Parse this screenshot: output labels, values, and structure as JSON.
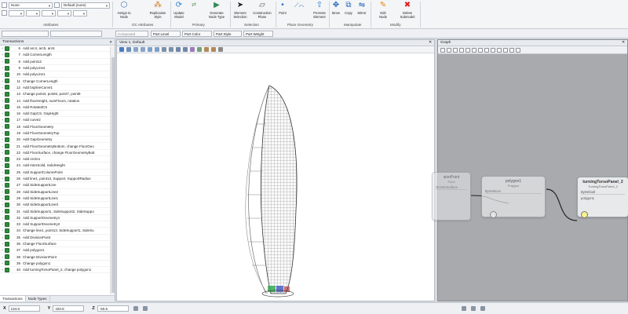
{
  "ribbon": {
    "combos": {
      "level": "None",
      "template": "Default (none)"
    },
    "groups": {
      "attributes": "Attributes",
      "gc_attributes": "GC Attributes",
      "primary": "Primary",
      "selection": "Selection",
      "place_geometry": "Place Geometry",
      "manipulate": "Manipulate",
      "modify": "Modify"
    },
    "buttons": {
      "assign_to_node": "Assign to Node",
      "replication_style": "Replication Style",
      "update_model": "Update Model",
      "generate_node_type": "Generate Node Type",
      "element_selection": "Element Selection",
      "construction_plane": "Construction Plane",
      "point": "Point",
      "promote_element": "Promote Element",
      "move": "Move",
      "copy": "Copy",
      "mirror": "Mirror",
      "edit_node": "Edit Node",
      "delete_submodel": "Delete Submodel"
    }
  },
  "toolbar2": {
    "compound": "Compound",
    "part_level": "Part Level",
    "part_color": "Part Color",
    "part_style": "Part Style",
    "part_weight": "Part Weight"
  },
  "transactions": {
    "title": "Transactions",
    "rows": [
      {
        "n": "6",
        "label": "Add arc4, arc5, arc6"
      },
      {
        "n": "7",
        "label": "Add CornerLength"
      },
      {
        "n": "8",
        "label": "Add point12"
      },
      {
        "n": "9",
        "label": "Add polyLine2"
      },
      {
        "n": "10",
        "label": "Add polyLine1"
      },
      {
        "n": "11",
        "label": "Change CornerLength"
      },
      {
        "n": "12",
        "label": "Add bsplineCurve1"
      },
      {
        "n": "13",
        "label": "Change point4, point6, point7, point8"
      },
      {
        "n": "14",
        "label": "Add floorHeight, numFloors, rotation"
      },
      {
        "n": "15",
        "label": "Add RotatedCS"
      },
      {
        "n": "16",
        "label": "Add GapCS, GapHight"
      },
      {
        "n": "17",
        "label": "Add curve2"
      },
      {
        "n": "18",
        "label": "Add FloorGeometry"
      },
      {
        "n": "19",
        "label": "Add FloorGeometryTop"
      },
      {
        "n": "20",
        "label": "Add GapGeometry"
      },
      {
        "n": "21",
        "label": "Add FloorGeometryBottom, change FloorGeo"
      },
      {
        "n": "22",
        "label": "Add FloorSurface, change FloorGeometryBott"
      },
      {
        "n": "23",
        "label": "Add circle1"
      },
      {
        "n": "24",
        "label": "Add InterSolid, SolidHeight"
      },
      {
        "n": "25",
        "label": "Add SupportColumnPoint"
      },
      {
        "n": "26",
        "label": "Add line1, point13, Support, SupportRadius"
      },
      {
        "n": "27",
        "label": "Add SideSupportLine"
      },
      {
        "n": "28",
        "label": "Add SideSupportLine2"
      },
      {
        "n": "29",
        "label": "Add SideSupportLine1"
      },
      {
        "n": "30",
        "label": "Add SideSupportLine3"
      },
      {
        "n": "31",
        "label": "Add SideSupport1, SideSupport2, SideSuppo"
      },
      {
        "n": "32",
        "label": "Add SupportGeometry1"
      },
      {
        "n": "33",
        "label": "Add SupportGeometry2"
      },
      {
        "n": "34",
        "label": "Change line1, point13, SideSupport1, SideSu"
      },
      {
        "n": "35",
        "label": "Add DivisionPoint"
      },
      {
        "n": "36",
        "label": "Change FloorSurface"
      },
      {
        "n": "37",
        "label": "Add polygon1"
      },
      {
        "n": "38",
        "label": "Change DivisionPoint"
      },
      {
        "n": "39",
        "label": "Change polygon1"
      },
      {
        "n": "40",
        "label": "Add turningTorsoPanel_2, change polygon1"
      }
    ],
    "tabs": [
      "Transactions",
      "Node Types"
    ]
  },
  "view": {
    "title": "View 1, Default"
  },
  "graph": {
    "title": "Graph",
    "nodes": {
      "division_point": {
        "title": "sionPoint",
        "subtitle": "Point",
        "param": "ttionOnSurface"
      },
      "polygon": {
        "title": "polygon1",
        "subtitle": "Polygon",
        "param": "ByVertices"
      },
      "panel": {
        "title": "turningTorsoPanel_2",
        "subtitle": "TurningTorsoPanel_2",
        "param": "ByDefault",
        "port": "polygon1"
      }
    }
  },
  "status": {
    "x_label": "X",
    "x_value": "134.8",
    "y_label": "Y",
    "y_value": "420.8",
    "z_label": "Z",
    "z_value": "-60.6"
  }
}
